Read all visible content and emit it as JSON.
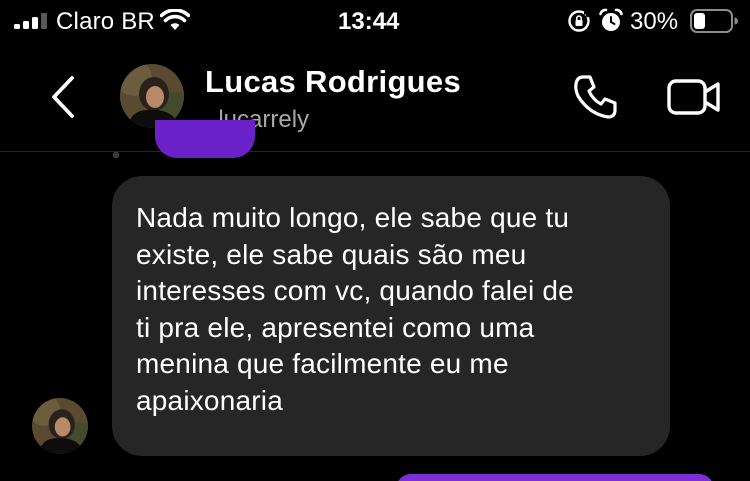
{
  "status_bar": {
    "carrier": "Claro BR",
    "time": "13:44",
    "battery_percent": "30%",
    "battery_level": 0.3,
    "icons": [
      "signal-icon",
      "wifi-icon",
      "rotation-lock-icon",
      "alarm-icon",
      "battery-icon"
    ]
  },
  "header": {
    "contact_name": "Lucas Rodrigues",
    "username": "_lucarrely",
    "icons": [
      "back-icon",
      "phone-icon",
      "video-icon"
    ]
  },
  "messages": [
    {
      "sender": "contact",
      "text": "Nada muito longo, ele sabe que tu existe, ele sabe quais são meu interesses com vc, quando falei de ti pra ele, apresentei como uma menina que facilmente eu me apaixonaria",
      "lines": [
        "Nada muito longo, ele sabe que tu",
        "existe, ele sabe quais são meu",
        "interesses com vc, quando falei de",
        "ti pra ele, apresentei como uma",
        "menina que facilmente eu me",
        "apaixonaria"
      ]
    }
  ],
  "colors": {
    "background": "#000000",
    "incoming_bubble": "#262626",
    "outgoing_bubble": "#7b2fd6",
    "secondary_text": "#a8a8a8"
  }
}
